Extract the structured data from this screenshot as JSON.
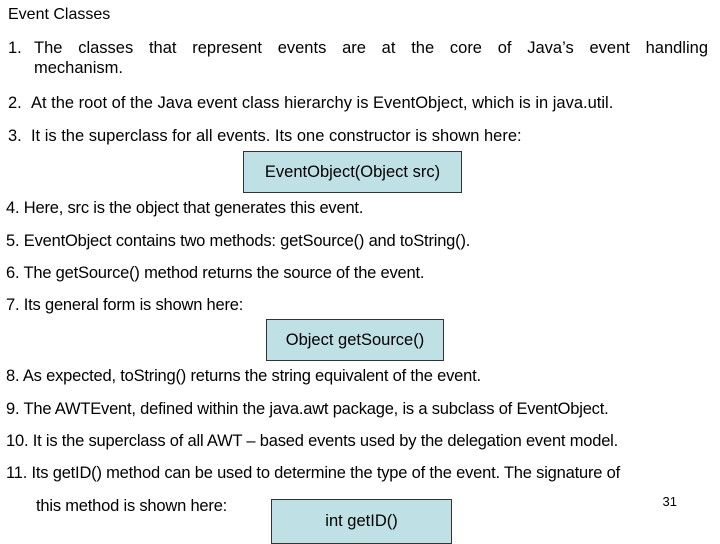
{
  "title": "Event Classes",
  "items": [
    {
      "num": "1.",
      "text_line1": "The classes that represent events are at the core of Java’s event handling",
      "text_line2": "mechanism."
    },
    {
      "num": "2.",
      "text": "At the root of the Java event class hierarchy is EventObject, which is in java.util."
    },
    {
      "num": "3.",
      "text": "It is the superclass for all events. Its one constructor is shown here:"
    },
    {
      "num": "4.",
      "text": "Here, src is the object that generates this event."
    },
    {
      "num": "5.",
      "text": "EventObject contains two methods: getSource() and toString()."
    },
    {
      "num": "6.",
      "text": "The getSource() method returns the source of the event."
    },
    {
      "num": "7.",
      "text": "Its general form is shown here:"
    },
    {
      "num": "8.",
      "text": "As expected, toString() returns the string equivalent of the event."
    },
    {
      "num": "9.",
      "text": "The AWTEvent, defined within the java.awt package, is a subclass of EventObject."
    },
    {
      "num": "10.",
      "text": "It is the superclass of all AWT – based events used by the delegation event model."
    },
    {
      "num": "11.",
      "text_line1": "Its getID() method can be used to determine the type of the event. The signature of",
      "text_line2": "this method is shown here:"
    }
  ],
  "code_boxes": {
    "constructor": "EventObject(Object src)",
    "get_source": "Object getSource()",
    "get_id": "int getID()"
  },
  "colors": {
    "code_box_bg": "#bfe0e4"
  },
  "page_number": "31"
}
